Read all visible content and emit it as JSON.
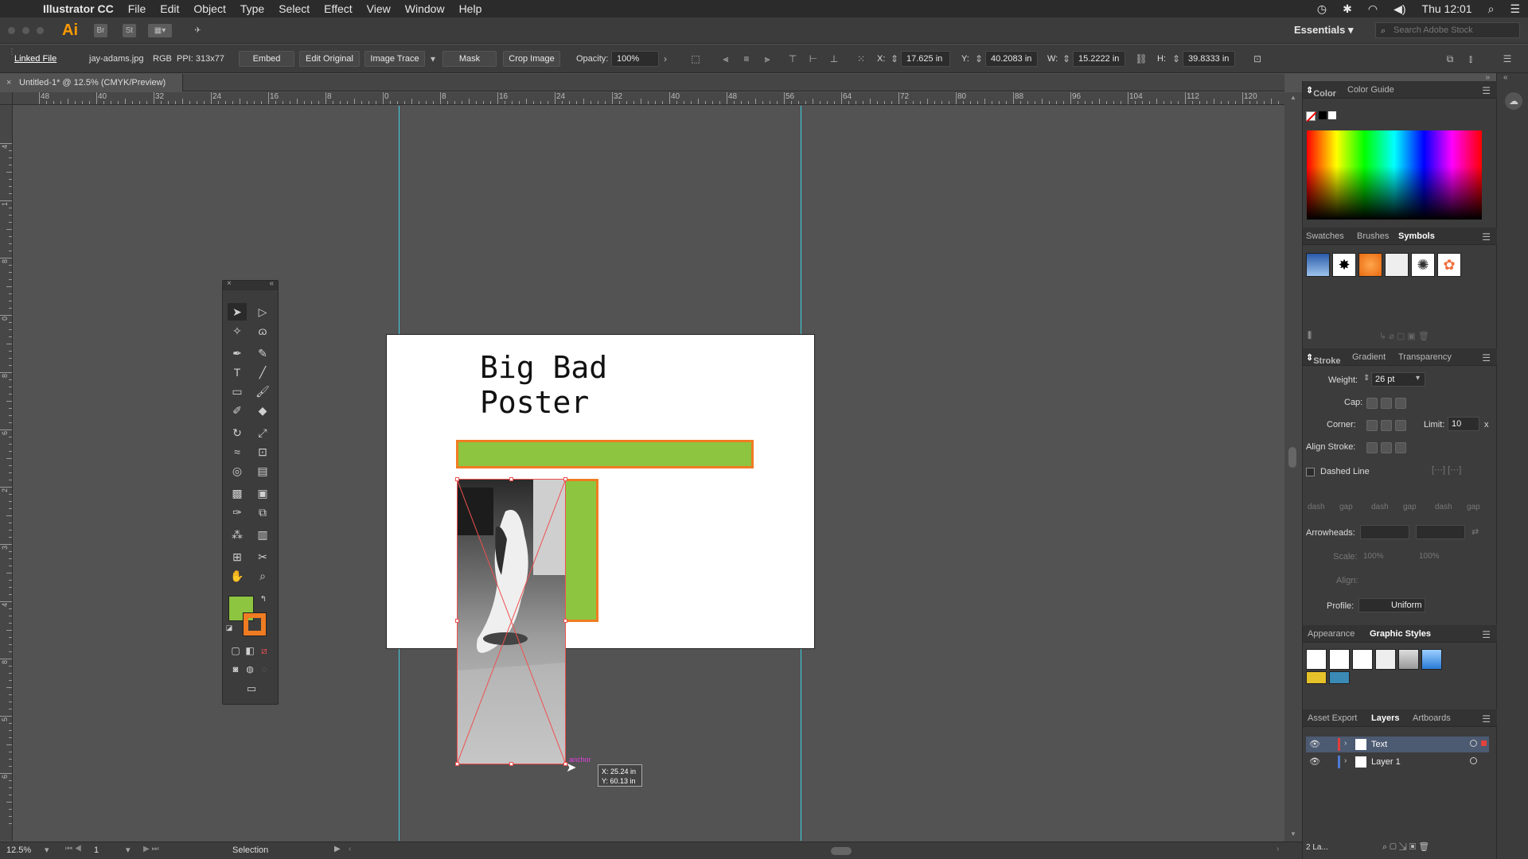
{
  "menubar": {
    "app_name": "Illustrator CC",
    "items": [
      "File",
      "Edit",
      "Object",
      "Type",
      "Select",
      "Effect",
      "View",
      "Window",
      "Help"
    ],
    "clock": "Thu 12:01"
  },
  "appbar": {
    "logo": "Ai",
    "bridge": "Br",
    "stock": "St",
    "workspace": "Essentials",
    "search_placeholder": "Search Adobe Stock"
  },
  "controlbar": {
    "linked_file": "Linked File",
    "filename": "jay-adams.jpg",
    "color_mode": "RGB",
    "ppi": "PPI: 313x77",
    "embed": "Embed",
    "edit_original": "Edit Original",
    "image_trace": "Image Trace",
    "mask": "Mask",
    "crop_image": "Crop Image",
    "opacity_label": "Opacity:",
    "opacity_value": "100%",
    "x_label": "X:",
    "x_value": "17.625 in",
    "y_label": "Y:",
    "y_value": "40.2083 in",
    "w_label": "W:",
    "w_value": "15.2222 in",
    "h_label": "H:",
    "h_value": "39.8333 in"
  },
  "document": {
    "tab_title": "Untitled-1* @ 12.5% (CMYK/Preview)",
    "poster_title": "Big Bad Poster",
    "anchor_label": "anchor",
    "tooltip_x": "X: 25.24 in",
    "tooltip_y": "Y: 60.13 in"
  },
  "ruler": {
    "h_labels": [
      "48",
      "40",
      "32",
      "24",
      "16",
      "8",
      "0",
      "8",
      "16",
      "24",
      "32",
      "40",
      "48",
      "56",
      "64",
      "72",
      "80",
      "88",
      "96",
      "104",
      "112",
      "120"
    ],
    "v_labels": [
      "4",
      "1",
      "8",
      "0",
      "8",
      "6",
      "2",
      "3",
      "4",
      "8",
      "5",
      "6"
    ]
  },
  "panels": {
    "color_tab": "Color",
    "color_guide_tab": "Color Guide",
    "swatches_tab": "Swatches",
    "brushes_tab": "Brushes",
    "symbols_tab": "Symbols",
    "stroke_tab": "Stroke",
    "gradient_tab": "Gradient",
    "transparency_tab": "Transparency",
    "weight_label": "Weight:",
    "weight_value": "26 pt",
    "cap_label": "Cap:",
    "corner_label": "Corner:",
    "limit_label": "Limit:",
    "limit_value": "10",
    "limit_unit": "x",
    "align_stroke_label": "Align Stroke:",
    "dashed_line": "Dashed Line",
    "dash_labels": [
      "dash",
      "gap",
      "dash",
      "gap",
      "dash",
      "gap"
    ],
    "arrowheads_label": "Arrowheads:",
    "scale_label": "Scale:",
    "scale_a": "100%",
    "scale_b": "100%",
    "align_label": "Align:",
    "profile_label": "Profile:",
    "profile_value": "Uniform",
    "appearance_tab": "Appearance",
    "graphic_styles_tab": "Graphic Styles",
    "asset_export_tab": "Asset Export",
    "layers_tab": "Layers",
    "artboards_tab": "Artboards",
    "layers": [
      {
        "name": "Text",
        "color": "#e0423c"
      },
      {
        "name": "Layer 1",
        "color": "#4d7bd6"
      }
    ],
    "layer_count": "2 La..."
  },
  "statusbar": {
    "zoom": "12.5%",
    "page": "1",
    "tool": "Selection"
  },
  "colors": {
    "green_fill": "#8dc540",
    "orange_stroke": "#f07c22",
    "guide_cyan": "#3fd0e0",
    "ai_orange": "#ff9a00"
  }
}
